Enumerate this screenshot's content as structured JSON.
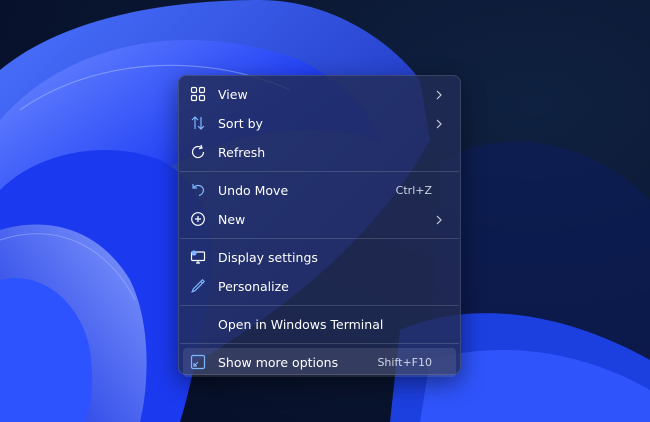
{
  "context_menu": {
    "items": [
      {
        "label": "View",
        "icon": "grid-icon",
        "submenu": true
      },
      {
        "label": "Sort by",
        "icon": "sort-arrows-icon",
        "submenu": true
      },
      {
        "label": "Refresh",
        "icon": "refresh-icon"
      },
      {
        "label": "Undo Move",
        "icon": "undo-icon",
        "shortcut": "Ctrl+Z"
      },
      {
        "label": "New",
        "icon": "plus-circle-icon",
        "submenu": true
      },
      {
        "label": "Display settings",
        "icon": "display-settings-icon"
      },
      {
        "label": "Personalize",
        "icon": "pen-icon"
      },
      {
        "label": "Open in Windows Terminal",
        "icon": ""
      },
      {
        "label": "Show more options",
        "icon": "expand-window-icon",
        "shortcut": "Shift+F10",
        "highlighted": true
      }
    ]
  },
  "colors": {
    "icon_accent": "#7fb6ff",
    "text": "#ffffff",
    "wallpaper_blue": "#2a5cff"
  }
}
